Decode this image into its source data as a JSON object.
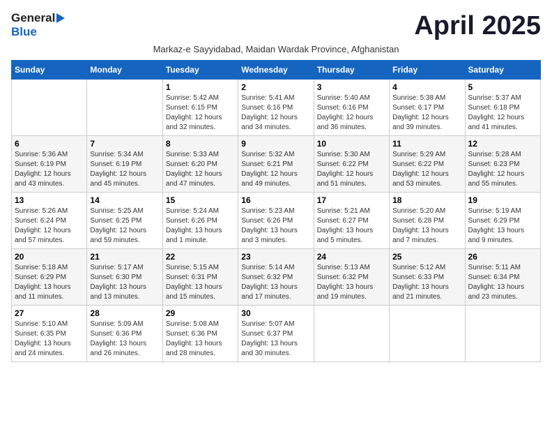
{
  "header": {
    "logo_general": "General",
    "logo_blue": "Blue",
    "title": "April 2025",
    "subtitle": "Markaz-e Sayyidabad, Maidan Wardak Province, Afghanistan"
  },
  "calendar": {
    "days_of_week": [
      "Sunday",
      "Monday",
      "Tuesday",
      "Wednesday",
      "Thursday",
      "Friday",
      "Saturday"
    ],
    "weeks": [
      [
        {
          "day": "",
          "info": ""
        },
        {
          "day": "",
          "info": ""
        },
        {
          "day": "1",
          "info": "Sunrise: 5:42 AM\nSunset: 6:15 PM\nDaylight: 12 hours and 32 minutes."
        },
        {
          "day": "2",
          "info": "Sunrise: 5:41 AM\nSunset: 6:16 PM\nDaylight: 12 hours and 34 minutes."
        },
        {
          "day": "3",
          "info": "Sunrise: 5:40 AM\nSunset: 6:16 PM\nDaylight: 12 hours and 36 minutes."
        },
        {
          "day": "4",
          "info": "Sunrise: 5:38 AM\nSunset: 6:17 PM\nDaylight: 12 hours and 39 minutes."
        },
        {
          "day": "5",
          "info": "Sunrise: 5:37 AM\nSunset: 6:18 PM\nDaylight: 12 hours and 41 minutes."
        }
      ],
      [
        {
          "day": "6",
          "info": "Sunrise: 5:36 AM\nSunset: 6:19 PM\nDaylight: 12 hours and 43 minutes."
        },
        {
          "day": "7",
          "info": "Sunrise: 5:34 AM\nSunset: 6:19 PM\nDaylight: 12 hours and 45 minutes."
        },
        {
          "day": "8",
          "info": "Sunrise: 5:33 AM\nSunset: 6:20 PM\nDaylight: 12 hours and 47 minutes."
        },
        {
          "day": "9",
          "info": "Sunrise: 5:32 AM\nSunset: 6:21 PM\nDaylight: 12 hours and 49 minutes."
        },
        {
          "day": "10",
          "info": "Sunrise: 5:30 AM\nSunset: 6:22 PM\nDaylight: 12 hours and 51 minutes."
        },
        {
          "day": "11",
          "info": "Sunrise: 5:29 AM\nSunset: 6:22 PM\nDaylight: 12 hours and 53 minutes."
        },
        {
          "day": "12",
          "info": "Sunrise: 5:28 AM\nSunset: 6:23 PM\nDaylight: 12 hours and 55 minutes."
        }
      ],
      [
        {
          "day": "13",
          "info": "Sunrise: 5:26 AM\nSunset: 6:24 PM\nDaylight: 12 hours and 57 minutes."
        },
        {
          "day": "14",
          "info": "Sunrise: 5:25 AM\nSunset: 6:25 PM\nDaylight: 12 hours and 59 minutes."
        },
        {
          "day": "15",
          "info": "Sunrise: 5:24 AM\nSunset: 6:26 PM\nDaylight: 13 hours and 1 minute."
        },
        {
          "day": "16",
          "info": "Sunrise: 5:23 AM\nSunset: 6:26 PM\nDaylight: 13 hours and 3 minutes."
        },
        {
          "day": "17",
          "info": "Sunrise: 5:21 AM\nSunset: 6:27 PM\nDaylight: 13 hours and 5 minutes."
        },
        {
          "day": "18",
          "info": "Sunrise: 5:20 AM\nSunset: 6:28 PM\nDaylight: 13 hours and 7 minutes."
        },
        {
          "day": "19",
          "info": "Sunrise: 5:19 AM\nSunset: 6:29 PM\nDaylight: 13 hours and 9 minutes."
        }
      ],
      [
        {
          "day": "20",
          "info": "Sunrise: 5:18 AM\nSunset: 6:29 PM\nDaylight: 13 hours and 11 minutes."
        },
        {
          "day": "21",
          "info": "Sunrise: 5:17 AM\nSunset: 6:30 PM\nDaylight: 13 hours and 13 minutes."
        },
        {
          "day": "22",
          "info": "Sunrise: 5:15 AM\nSunset: 6:31 PM\nDaylight: 13 hours and 15 minutes."
        },
        {
          "day": "23",
          "info": "Sunrise: 5:14 AM\nSunset: 6:32 PM\nDaylight: 13 hours and 17 minutes."
        },
        {
          "day": "24",
          "info": "Sunrise: 5:13 AM\nSunset: 6:32 PM\nDaylight: 13 hours and 19 minutes."
        },
        {
          "day": "25",
          "info": "Sunrise: 5:12 AM\nSunset: 6:33 PM\nDaylight: 13 hours and 21 minutes."
        },
        {
          "day": "26",
          "info": "Sunrise: 5:11 AM\nSunset: 6:34 PM\nDaylight: 13 hours and 23 minutes."
        }
      ],
      [
        {
          "day": "27",
          "info": "Sunrise: 5:10 AM\nSunset: 6:35 PM\nDaylight: 13 hours and 24 minutes."
        },
        {
          "day": "28",
          "info": "Sunrise: 5:09 AM\nSunset: 6:36 PM\nDaylight: 13 hours and 26 minutes."
        },
        {
          "day": "29",
          "info": "Sunrise: 5:08 AM\nSunset: 6:36 PM\nDaylight: 13 hours and 28 minutes."
        },
        {
          "day": "30",
          "info": "Sunrise: 5:07 AM\nSunset: 6:37 PM\nDaylight: 13 hours and 30 minutes."
        },
        {
          "day": "",
          "info": ""
        },
        {
          "day": "",
          "info": ""
        },
        {
          "day": "",
          "info": ""
        }
      ]
    ]
  }
}
